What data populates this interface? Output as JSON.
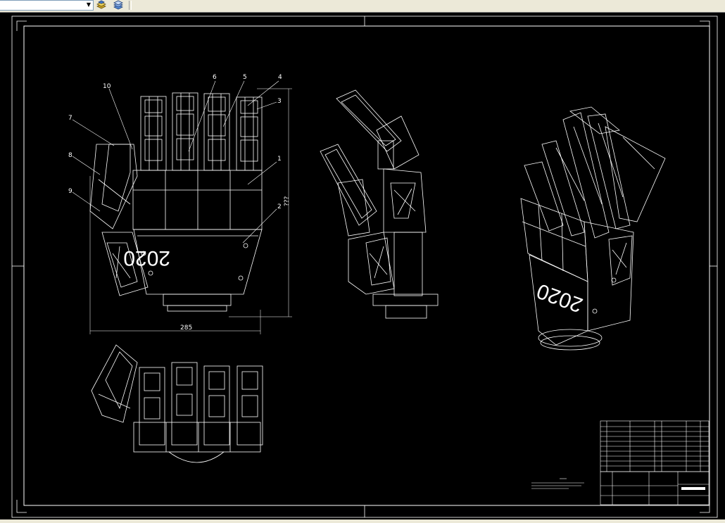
{
  "toolbar": {
    "layer_combo_value": "",
    "layer_combo_arrow": "▼"
  },
  "drawing": {
    "balloons": [
      "1",
      "2",
      "3",
      "4",
      "5",
      "6",
      "7",
      "8",
      "9",
      "10"
    ],
    "palm_logo": "2020",
    "iso_logo": "2020",
    "dim_height": "???",
    "dim_width": "285"
  },
  "colors": {
    "linework": "#ffffff",
    "background": "#000000",
    "ui_face": "#ece9d8"
  }
}
